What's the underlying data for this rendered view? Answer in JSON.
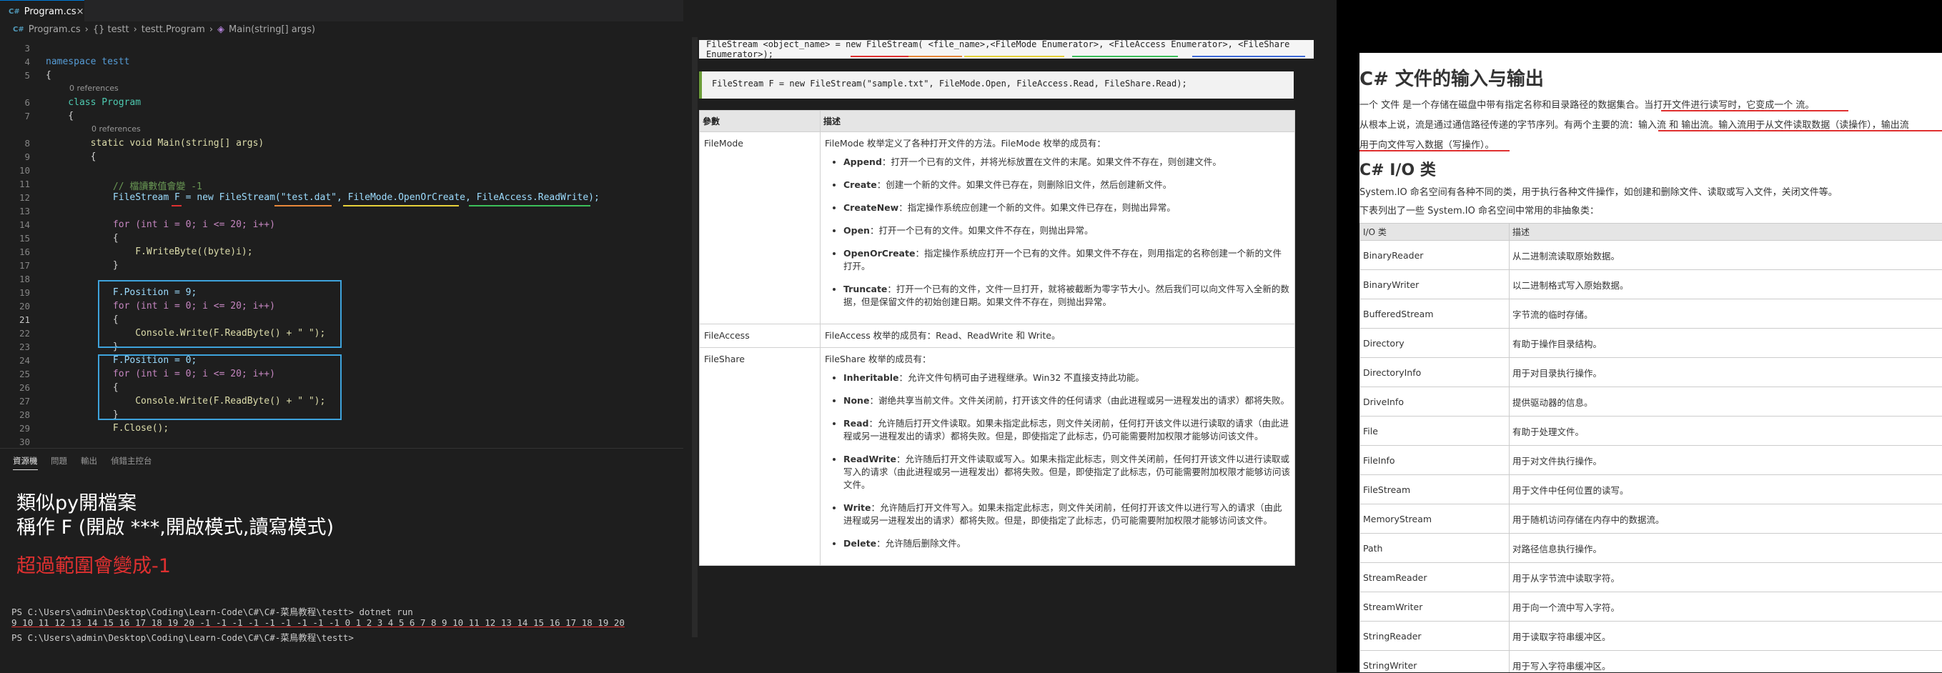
{
  "editor": {
    "tab_label": "Program.cs",
    "breadcrumb": [
      "Program.cs",
      "{} testt",
      "testt.Program",
      "Main(string[] args)"
    ],
    "references": "0 references",
    "lines": [
      {
        "n": "3",
        "html": ""
      },
      {
        "n": "4",
        "text": "namespace testt"
      },
      {
        "n": "5",
        "text": "{"
      },
      {
        "n": "6",
        "text": "    class Program"
      },
      {
        "n": "7",
        "text": "    {"
      },
      {
        "n": "8",
        "text": "        static void Main(string[] args)"
      },
      {
        "n": "9",
        "text": "        {"
      },
      {
        "n": "10",
        "text": ""
      },
      {
        "n": "11",
        "text": "            // 檔讀數值會變 -1"
      },
      {
        "n": "12",
        "text": "            FileStream F = new FileStream(\"test.dat\", FileMode.OpenOrCreate, FileAccess.ReadWrite);"
      },
      {
        "n": "13",
        "text": ""
      },
      {
        "n": "14",
        "text": "            for (int i = 0; i <= 20; i++)"
      },
      {
        "n": "15",
        "text": "            {"
      },
      {
        "n": "16",
        "text": "                F.WriteByte((byte)i);"
      },
      {
        "n": "17",
        "text": "            }"
      },
      {
        "n": "18",
        "text": ""
      },
      {
        "n": "19",
        "text": "            F.Position = 9;"
      },
      {
        "n": "20",
        "text": "            for (int i = 0; i <= 20; i++)"
      },
      {
        "n": "21",
        "text": "            {"
      },
      {
        "n": "22",
        "text": "                Console.Write(F.ReadByte() + \" \");"
      },
      {
        "n": "23",
        "text": "            }"
      },
      {
        "n": "24",
        "text": "            F.Position = 0;"
      },
      {
        "n": "25",
        "text": "            for (int i = 0; i <= 20; i++)"
      },
      {
        "n": "26",
        "text": "            {"
      },
      {
        "n": "27",
        "text": "                Console.Write(F.ReadByte() + \" \");"
      },
      {
        "n": "28",
        "text": "            }"
      },
      {
        "n": "29",
        "text": "            F.Close();"
      },
      {
        "n": "30",
        "text": ""
      }
    ]
  },
  "panel": {
    "tabs": [
      "資源機",
      "問題",
      "輸出",
      "偵錯主控台"
    ],
    "notes": [
      "類似py開檔案",
      "稱作 F (開啟 ***,開啟模式,讀寫模式)",
      "超過範圍會變成-1"
    ],
    "terminal": [
      "PS C:\\Users\\admin\\Desktop\\Coding\\Learn-Code\\C#\\C#-菜鳥教程\\testt> dotnet run",
      "9 10 11 12 13 14 15 16 17 18 19 20 -1 -1 -1 -1 -1 -1 -1 -1 -1 0 1 2 3 4 5 6 7 8 9 10 11 12 13 14 15 16 17 18 19 20",
      "PS C:\\Users\\admin\\Desktop\\Coding\\Learn-Code\\C#\\C#-菜鳥教程\\testt> "
    ]
  },
  "middle": {
    "syntax": "FileStream <object_name> = new FileStream( <file_name>,<FileMode Enumerator>, <FileAccess Enumerator>, <FileShare Enumerator>);",
    "example": "FileStream F = new FileStream(\"sample.txt\", FileMode.Open, FileAccess.Read, FileShare.Read);",
    "table": {
      "headers": [
        "參數",
        "描述"
      ],
      "filemode": {
        "name": "FileMode",
        "intro": "FileMode 枚举定义了各种打开文件的方法。FileMode 枚举的成员有：",
        "items": [
          {
            "k": "Append",
            "v": "：打开一个已有的文件，并将光标放置在文件的末尾。如果文件不存在，则创建文件。"
          },
          {
            "k": "Create",
            "v": "：创建一个新的文件。如果文件已存在，则删除旧文件，然后创建新文件。"
          },
          {
            "k": "CreateNew",
            "v": "：指定操作系统应创建一个新的文件。如果文件已存在，则抛出异常。"
          },
          {
            "k": "Open",
            "v": "：打开一个已有的文件。如果文件不存在，则抛出异常。"
          },
          {
            "k": "OpenOrCreate",
            "v": "：指定操作系统应打开一个已有的文件。如果文件不存在，则用指定的名称创建一个新的文件打开。"
          },
          {
            "k": "Truncate",
            "v": "：打开一个已有的文件，文件一旦打开，就将被截断为零字节大小。然后我们可以向文件写入全新的数据，但是保留文件的初始创建日期。如果文件不存在，则抛出异常。"
          }
        ]
      },
      "fileaccess": {
        "name": "FileAccess",
        "desc": "FileAccess 枚举的成员有：Read、ReadWrite 和 Write。"
      },
      "fileshare": {
        "name": "FileShare",
        "intro": "FileShare 枚举的成员有：",
        "items": [
          {
            "k": "Inheritable",
            "v": "：允许文件句柄可由子进程继承。Win32 不直接支持此功能。"
          },
          {
            "k": "None",
            "v": "：谢绝共享当前文件。文件关闭前，打开该文件的任何请求（由此进程或另一进程发出的请求）都将失败。"
          },
          {
            "k": "Read",
            "v": "：允许随后打开文件读取。如果未指定此标志，则文件关闭前，任何打开该文件以进行读取的请求（由此进程或另一进程发出的请求）都将失败。但是，即使指定了此标志，仍可能需要附加权限才能够访问该文件。"
          },
          {
            "k": "ReadWrite",
            "v": "：允许随后打开文件读取或写入。如果未指定此标志，则文件关闭前，任何打开该文件以进行读取或写入的请求（由此进程或另一进程发出）都将失败。但是，即使指定了此标志，仍可能需要附加权限才能够访问该文件。"
          },
          {
            "k": "Write",
            "v": "：允许随后打开文件写入。如果未指定此标志，则文件关闭前，任何打开该文件以进行写入的请求（由此进程或另一进程发出的请求）都将失败。但是，即使指定了此标志，仍可能需要附加权限才能够访问该文件。"
          },
          {
            "k": "Delete",
            "v": "：允许随后删除文件。"
          }
        ]
      }
    }
  },
  "right": {
    "title": "C# 文件的输入与输出",
    "p1": "一个 文件 是一个存储在磁盘中带有指定名称和目录路径的数据集合。当打开文件进行读写时，它变成一个 流。",
    "p2": "从根本上说，流是通过通信路径传递的字节序列。有两个主要的流：输入流 和 输出流。输入流用于从文件读取数据（读操作），输出流",
    "p3": "用于向文件写入数据（写操作）。",
    "h2": "C# I/O 类",
    "p4": "System.IO 命名空间有各种不同的类，用于执行各种文件操作，如创建和删除文件、读取或写入文件，关闭文件等。",
    "p5": "下表列出了一些 System.IO 命名空间中常用的非抽象类：",
    "headers": [
      "I/O 类",
      "描述"
    ],
    "rows": [
      [
        "BinaryReader",
        "从二进制流读取原始数据。"
      ],
      [
        "BinaryWriter",
        "以二进制格式写入原始数据。"
      ],
      [
        "BufferedStream",
        "字节流的临时存储。"
      ],
      [
        "Directory",
        "有助于操作目录结构。"
      ],
      [
        "DirectoryInfo",
        "用于对目录执行操作。"
      ],
      [
        "DriveInfo",
        "提供驱动器的信息。"
      ],
      [
        "File",
        "有助于处理文件。"
      ],
      [
        "FileInfo",
        "用于对文件执行操作。"
      ],
      [
        "FileStream",
        "用于文件中任何位置的读写。"
      ],
      [
        "MemoryStream",
        "用于随机访问存储在内存中的数据流。"
      ],
      [
        "Path",
        "对路径信息执行操作。"
      ],
      [
        "StreamReader",
        "用于从字节流中读取字符。"
      ],
      [
        "StreamWriter",
        "用于向一个流中写入字符。"
      ],
      [
        "StringReader",
        "用于读取字符串缓冲区。"
      ],
      [
        "StringWriter",
        "用于写入字符串缓冲区。"
      ]
    ]
  },
  "colors": {
    "accent": "#0078d4",
    "note_red": "#e03030",
    "box_blue": "#3ea3dc"
  }
}
